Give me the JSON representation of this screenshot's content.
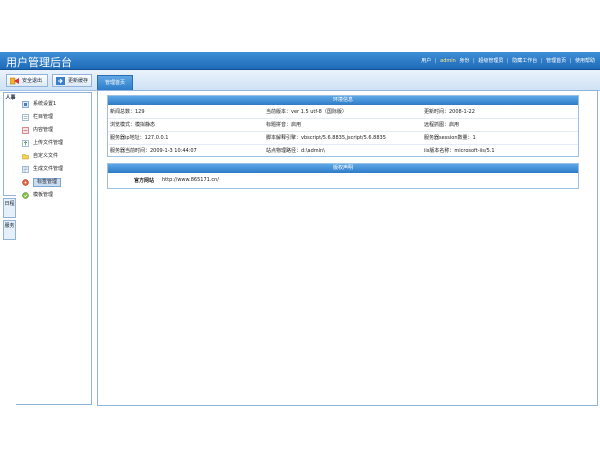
{
  "header": {
    "title": "用户管理后台",
    "user_label": "用户",
    "user_name": "admin",
    "role": "身份",
    "nav": [
      "超级管理员",
      "隐藏工作台",
      "管理首页",
      "使用帮助"
    ]
  },
  "toolbar": {
    "logout_label": "安全退出",
    "refresh_label": "更新缓存",
    "home_tab": "管理首页"
  },
  "sidebar": {
    "tabs": [
      "人事",
      "日程",
      "服务"
    ],
    "items": [
      {
        "label": "系统设置1",
        "icon": "settings-icon"
      },
      {
        "label": "栏目管理",
        "icon": "column-icon"
      },
      {
        "label": "内容管理",
        "icon": "content-icon"
      },
      {
        "label": "上传文件管理",
        "icon": "upload-icon"
      },
      {
        "label": "自定义文件",
        "icon": "folder-icon"
      },
      {
        "label": "生成文件管理",
        "icon": "generate-icon"
      },
      {
        "label": "标签管理",
        "icon": "tag-icon"
      },
      {
        "label": "模板管理",
        "icon": "template-icon"
      }
    ],
    "active_index": 6
  },
  "info": {
    "title": "环境信息",
    "rows": [
      [
        "新闻总数：129",
        "当前版本：ver 1.5 utf-8（国际版）",
        "更新时间：2008-1-22"
      ],
      [
        "浏览模式：模拟静态",
        "标题拼音：启用",
        "远程抓图：启用"
      ],
      [
        "服务器ip地址：127.0.0.1",
        "脚本解释引擎：vbscript/5.6.8835,jscript/5.6.8835",
        "服务器session数量：1"
      ],
      [
        "服务器当前时间：2009-1-3 10:44:07",
        "站点物理路径：d:\\admin\\",
        "iis版本名称：microsoft-iis/5.1"
      ]
    ]
  },
  "notice": {
    "title": "版权声明",
    "site_label": "官方网站",
    "site_url": "http://www.865171.cn/"
  },
  "colors": {
    "header_blue": "#1e6ab8",
    "panel_border": "#8fb3da",
    "title_bar": "#2e7cc8"
  }
}
